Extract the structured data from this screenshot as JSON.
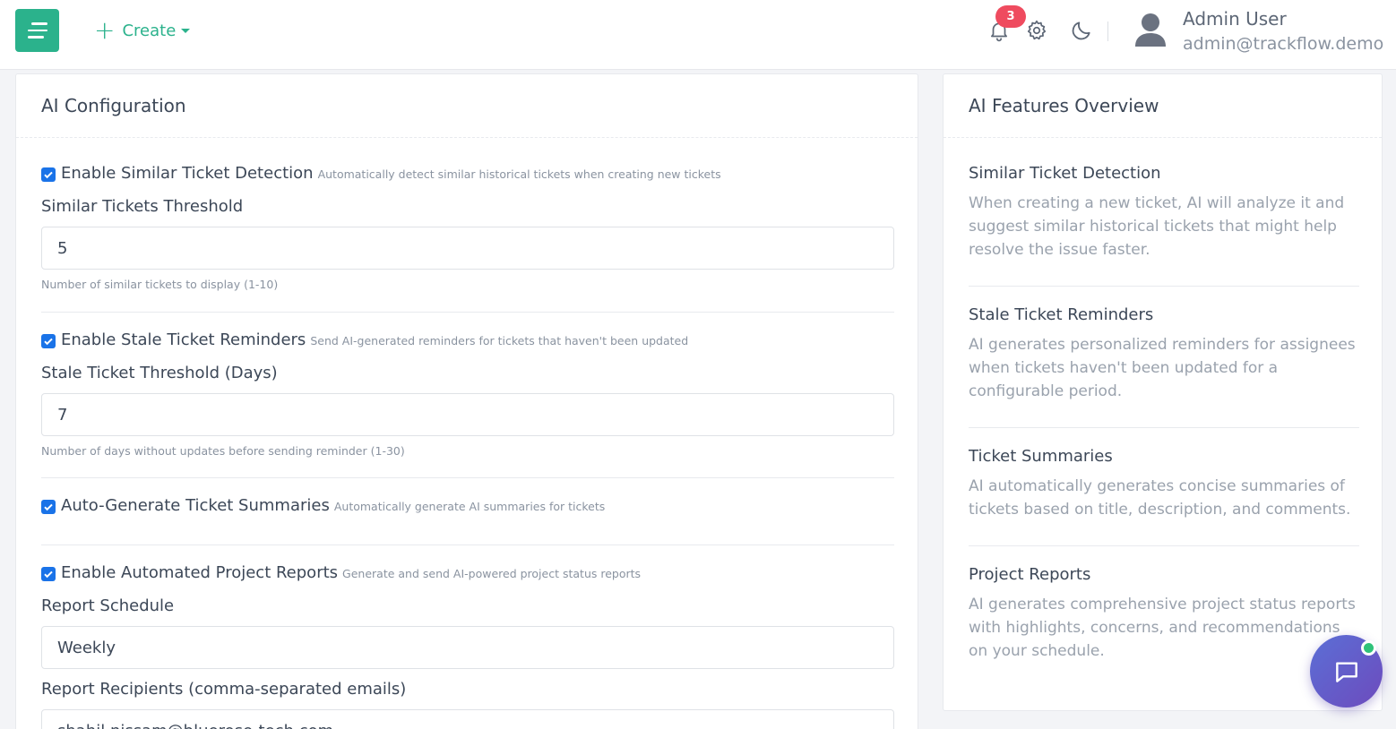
{
  "header": {
    "create_label": "Create",
    "notification_count": "3",
    "user": {
      "name": "Admin User",
      "email": "admin@trackflow.demo"
    }
  },
  "config": {
    "title": "AI Configuration",
    "similar": {
      "label": "Enable Similar Ticket Detection",
      "hint": "Automatically detect similar historical tickets when creating new tickets",
      "checked": true,
      "field_label": "Similar Tickets Threshold",
      "value": "5",
      "help": "Number of similar tickets to display (1-10)"
    },
    "stale": {
      "label": "Enable Stale Ticket Reminders",
      "hint": "Send AI-generated reminders for tickets that haven't been updated",
      "checked": true,
      "field_label": "Stale Ticket Threshold (Days)",
      "value": "7",
      "help": "Number of days without updates before sending reminder (1-30)"
    },
    "summaries": {
      "label": "Auto-Generate Ticket Summaries",
      "hint": "Automatically generate AI summaries for tickets",
      "checked": true
    },
    "reports": {
      "label": "Enable Automated Project Reports",
      "hint": "Generate and send AI-powered project status reports",
      "checked": true,
      "schedule_label": "Report Schedule",
      "schedule_value": "Weekly",
      "recipients_label": "Report Recipients (comma-separated emails)",
      "recipients_value": "shahil.nissam@bluerose-tech.com"
    }
  },
  "overview": {
    "title": "AI Features Overview",
    "items": [
      {
        "title": "Similar Ticket Detection",
        "desc": "When creating a new ticket, AI will analyze it and suggest similar historical tickets that might help resolve the issue faster."
      },
      {
        "title": "Stale Ticket Reminders",
        "desc": "AI generates personalized reminders for assignees when tickets haven't been updated for a configurable period."
      },
      {
        "title": "Ticket Summaries",
        "desc": "AI automatically generates concise summaries of tickets based on title, description, and comments."
      },
      {
        "title": "Project Reports",
        "desc": "AI generates comprehensive project status reports with highlights, concerns, and recommendations on your schedule."
      }
    ]
  },
  "colors": {
    "accent": "#2bb28c",
    "checkbox": "#1a73e8",
    "badge": "#ef4b5f",
    "chat_gradient_start": "#5b6fd6",
    "chat_gradient_end": "#6d4bbd",
    "online": "#2fc27a"
  },
  "icons": [
    "menu-icon",
    "plus-icon",
    "caret-down-icon",
    "bell-icon",
    "gear-icon",
    "moon-icon",
    "user-avatar-icon",
    "check-icon",
    "chat-icon"
  ]
}
